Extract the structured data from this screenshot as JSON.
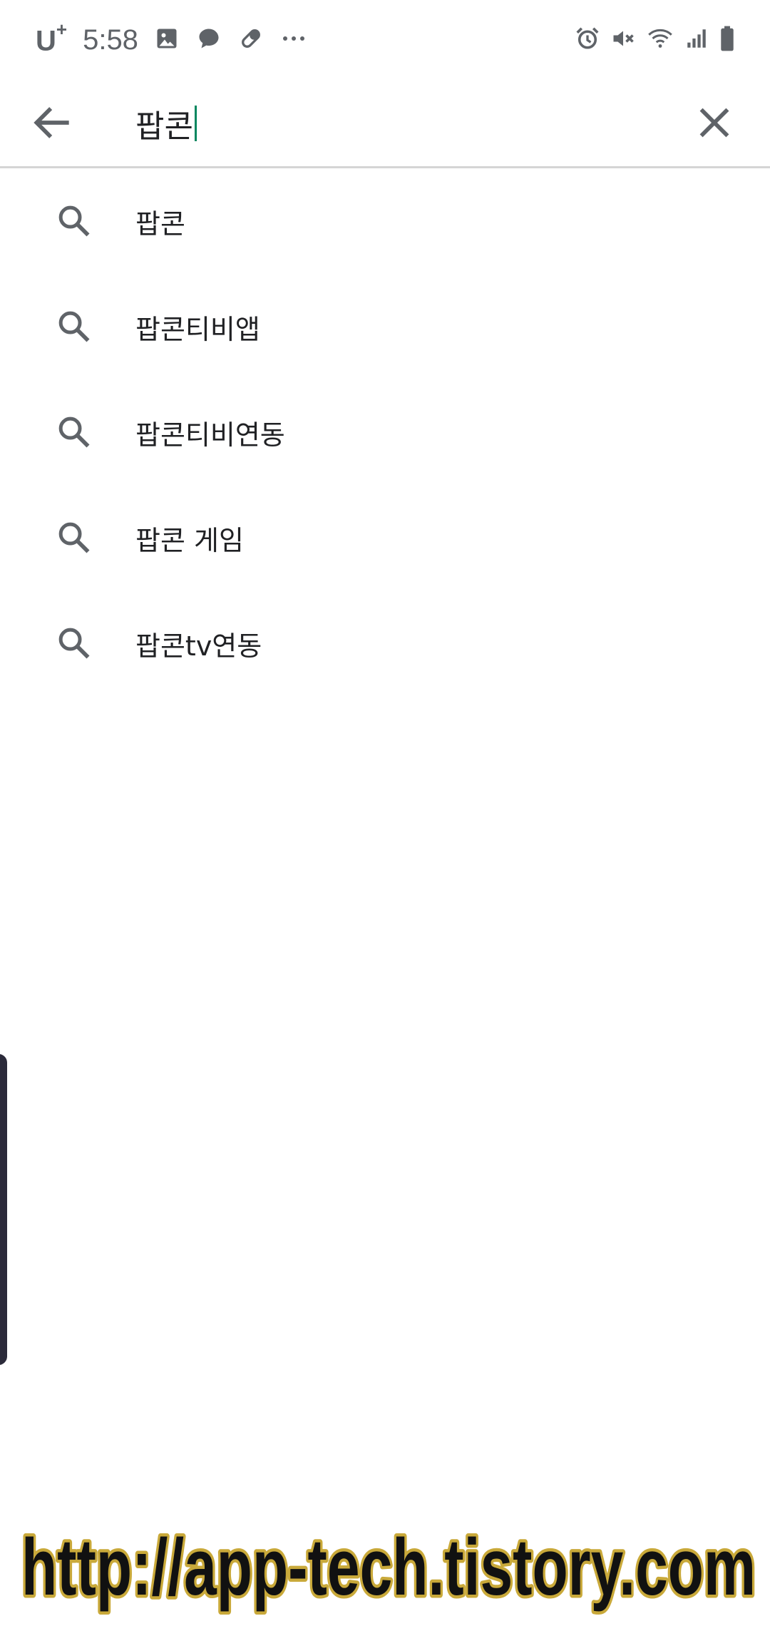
{
  "status_bar": {
    "carrier": "U",
    "carrier_suffix": "+",
    "time": "5:58",
    "left_icons": [
      "gallery-icon",
      "chat-icon",
      "pill-icon",
      "more-dots-icon"
    ],
    "right_icons": [
      "alarm-icon",
      "mute-icon",
      "wifi-icon",
      "signal-icon",
      "battery-icon"
    ]
  },
  "search": {
    "query": "팝콘",
    "caret_color": "#01875f"
  },
  "suggestions": [
    {
      "label": "팝콘"
    },
    {
      "label": "팝콘티비앱"
    },
    {
      "label": "팝콘티비연동"
    },
    {
      "label": "팝콘 게임"
    },
    {
      "label": "팝콘tv연동"
    }
  ],
  "watermark": {
    "text": "http://app-tech.tistory.com",
    "fill": "#111111",
    "outline": "#c9a93a"
  }
}
